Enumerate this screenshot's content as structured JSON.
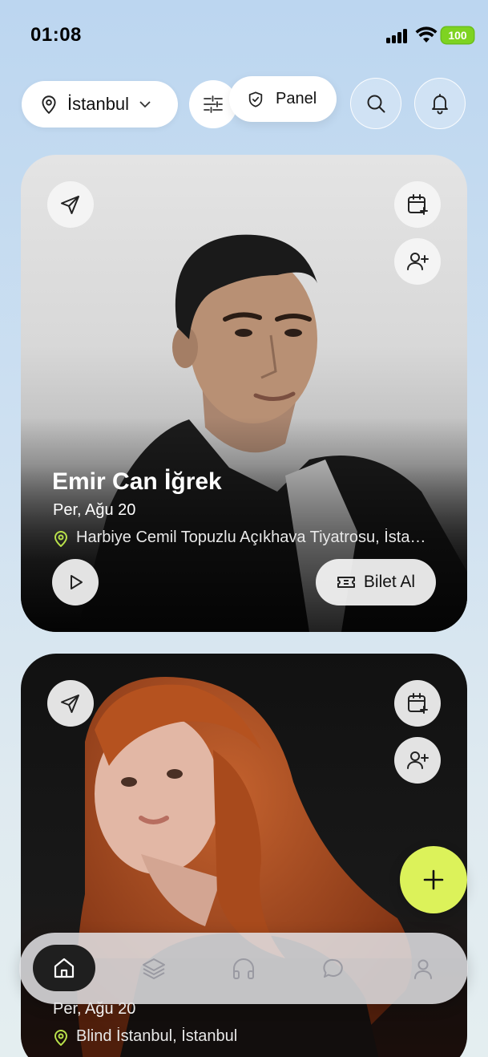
{
  "status_bar": {
    "time": "01:08",
    "battery": "100"
  },
  "header": {
    "city": "İstanbul",
    "panel_label": "Panel",
    "icons": [
      "location-pin-icon",
      "chevron-down-icon",
      "sliders-icon",
      "shield-icon",
      "search-icon",
      "bell-icon"
    ]
  },
  "events": [
    {
      "artist": "Emir Can İğrek",
      "date": "Per, Ağu 20",
      "venue": "Harbiye Cemil Topuzlu Açıkhava Tiyatrosu, İstanbul",
      "ticket_label": "Bilet Al"
    },
    {
      "artist": "",
      "date": "Per, Ağu 20",
      "venue": "Blind İstanbul, İstanbul"
    }
  ],
  "bottom_nav": {
    "items": [
      "home",
      "layers",
      "music",
      "chat",
      "profile"
    ],
    "active": "home"
  },
  "colors": {
    "accent_lime": "#dcf25a",
    "pin_green": "#b8e04a",
    "nav_active_bg": "#1f1f1f"
  }
}
